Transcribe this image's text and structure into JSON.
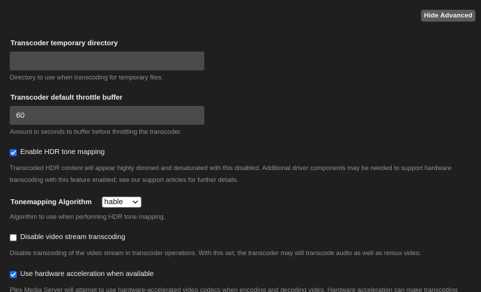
{
  "header": {
    "hide_advanced_label": "Hide Advanced"
  },
  "temp_dir": {
    "label": "Transcoder temporary directory",
    "value": "",
    "help": "Directory to use when transcoding for temporary files."
  },
  "throttle": {
    "label": "Transcoder default throttle buffer",
    "value": "60",
    "help": "Amount in seconds to buffer before throttling the transcoder."
  },
  "hdr": {
    "label": "Enable HDR tone mapping",
    "checked": true,
    "help_line1": "Transcoded HDR content will appear highly dimmed and desaturated with this disabled. Additional driver components may be needed to support hardware",
    "help_line2": "transcoding with this feature enabled; see our support articles for further details."
  },
  "tonemapping": {
    "label": "Tonemapping Algorithm",
    "selected": "hable",
    "help": "Algorithm to use when performing HDR tone mapping."
  },
  "disable_video": {
    "label": "Disable video stream transcoding",
    "checked": false,
    "help": "Disable transcoding of the video stream in transcoder operations. With this set, the transcoder may still transcode audio as well as remux video."
  },
  "hw_accel": {
    "label": "Use hardware acceleration when available",
    "checked": true,
    "help": "Plex Media Server will attempt to use hardware-accelerated video codecs when encoding and decoding video. Hardware acceleration can make transcoding"
  },
  "colors": {
    "background": "#1f1f1f",
    "input_bg": "#4a4a4a",
    "checkbox_accent": "#1a73e8",
    "help_text": "#8f8f8f"
  }
}
